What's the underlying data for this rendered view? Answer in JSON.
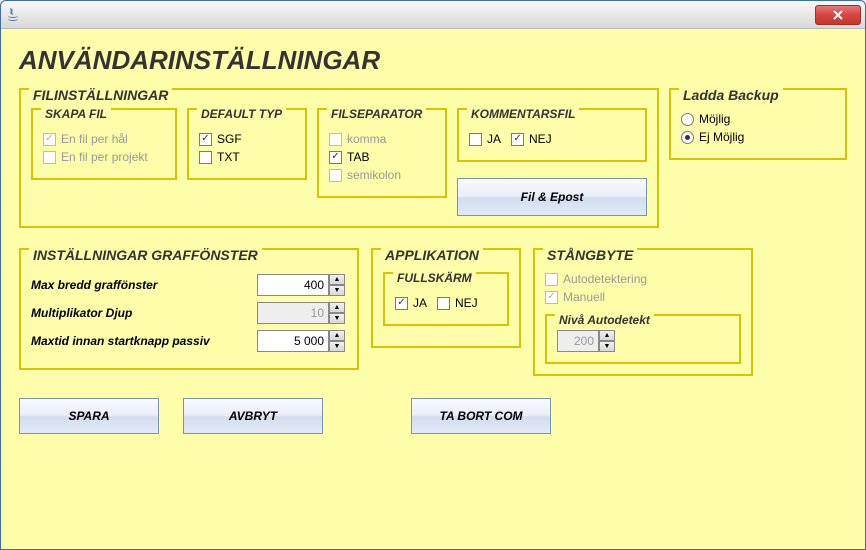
{
  "title": "ANVÄNDARINSTÄLLNINGAR",
  "fil": {
    "title": "FILINSTÄLLNINGAR",
    "skapa": {
      "title": "SKAPA FIL",
      "perHal": "En fil per hål",
      "perProjekt": "En fil per projekt"
    },
    "defaulttyp": {
      "title": "DEFAULT TYP",
      "sgf": "SGF",
      "txt": "TXT"
    },
    "sep": {
      "title": "FILSEPARATOR",
      "komma": "komma",
      "tab": "TAB",
      "semikolon": "semikolon"
    },
    "kommentar": {
      "title": "KOMMENTARSFIL",
      "ja": "JA",
      "nej": "NEJ"
    },
    "filEpost": "Fil & Epost"
  },
  "backup": {
    "title": "Ladda Backup",
    "mojlig": "Möjlig",
    "ejmojlig": "Ej Möjlig"
  },
  "graff": {
    "title": "INSTÄLLNINGAR GRAFFÖNSTER",
    "maxbredd": {
      "label": "Max bredd graffönster",
      "value": "400"
    },
    "mult": {
      "label": "Multiplikator Djup",
      "value": "10"
    },
    "maxtid": {
      "label": "Maxtid innan startknapp passiv",
      "value": "5 000"
    }
  },
  "applik": {
    "title": "APPLIKATION",
    "full": {
      "title": "FULLSKÄRM",
      "ja": "JA",
      "nej": "NEJ"
    }
  },
  "stang": {
    "title": "STÅNGBYTE",
    "auto": "Autodetektering",
    "manuell": "Manuell",
    "niva": {
      "title": "Nivå Autodetekt",
      "value": "200"
    }
  },
  "buttons": {
    "spara": "SPARA",
    "avbryt": "AVBRYT",
    "tabort": "TA BORT COM"
  }
}
